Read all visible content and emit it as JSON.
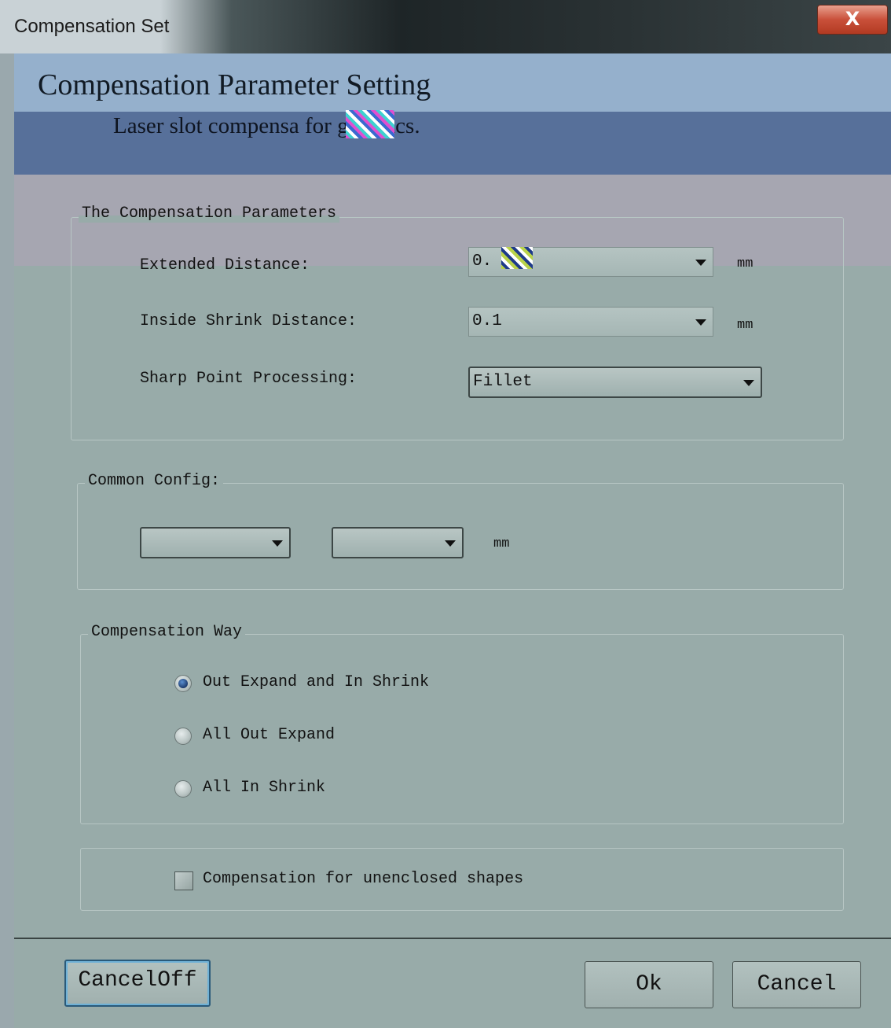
{
  "window": {
    "title": "Compensation Set",
    "close_glyph": "X"
  },
  "header": {
    "title": "Compensation Parameter Setting",
    "subtitle": "Laser slot compensa        for graphics."
  },
  "compensation_parameters": {
    "legend": "The Compensation Parameters",
    "extended_distance": {
      "label": "Extended Distance:",
      "value": "0.",
      "unit": "mm"
    },
    "inside_shrink_distance": {
      "label": "Inside Shrink Distance:",
      "value": "0.1",
      "unit": "mm"
    },
    "sharp_point_processing": {
      "label": "Sharp Point Processing:",
      "value": "Fillet"
    }
  },
  "common_config": {
    "legend": "Common Config:",
    "combo1_value": "",
    "combo2_value": "",
    "unit": "mm"
  },
  "compensation_way": {
    "legend": "Compensation Way",
    "options": [
      {
        "label": "Out Expand and In Shrink",
        "selected": true
      },
      {
        "label": "All Out Expand",
        "selected": false
      },
      {
        "label": "All In Shrink",
        "selected": false
      }
    ]
  },
  "unenclosed": {
    "label": "Compensation for unenclosed shapes",
    "checked": false
  },
  "buttons": {
    "cancel_off": "CancelOff",
    "ok": "Ok",
    "cancel": "Cancel"
  },
  "icons": {
    "close": "close-icon",
    "dropdown": "chevron-down-icon"
  }
}
